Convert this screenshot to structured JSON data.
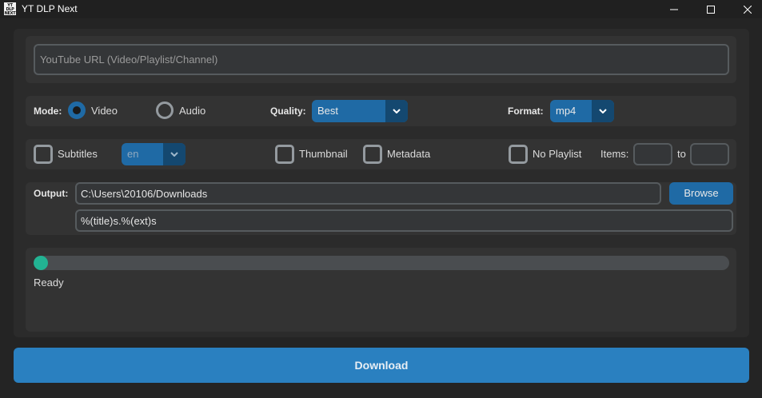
{
  "window": {
    "app_icon_text": [
      "YT",
      "DLP",
      "NEXT"
    ],
    "title": "YT DLP Next"
  },
  "url": {
    "placeholder": "YouTube URL (Video/Playlist/Channel)",
    "value": ""
  },
  "options": {
    "mode_label": "Mode:",
    "mode_video_label": "Video",
    "mode_audio_label": "Audio",
    "mode_selected": "Video",
    "quality_label": "Quality:",
    "quality_value": "Best",
    "format_label": "Format:",
    "format_value": "mp4"
  },
  "extras": {
    "subtitles_label": "Subtitles",
    "subtitles_checked": false,
    "subtitle_lang": "en",
    "thumbnail_label": "Thumbnail",
    "thumbnail_checked": false,
    "metadata_label": "Metadata",
    "metadata_checked": false,
    "no_playlist_label": "No Playlist",
    "no_playlist_checked": false,
    "items_label": "Items:",
    "items_from": "",
    "to_label": "to",
    "items_to": ""
  },
  "output": {
    "label": "Output:",
    "path": "C:\\Users\\20106/Downloads",
    "template": "%(title)s.%(ext)s",
    "browse_label": "Browse"
  },
  "progress": {
    "value": 0,
    "status": "Ready"
  },
  "actions": {
    "download_label": "Download"
  },
  "colors": {
    "background": "#242424",
    "panel": "#333333",
    "accent": "#1f6aa5",
    "download_button": "#2a80c0",
    "progress_fill": "#22b393"
  }
}
